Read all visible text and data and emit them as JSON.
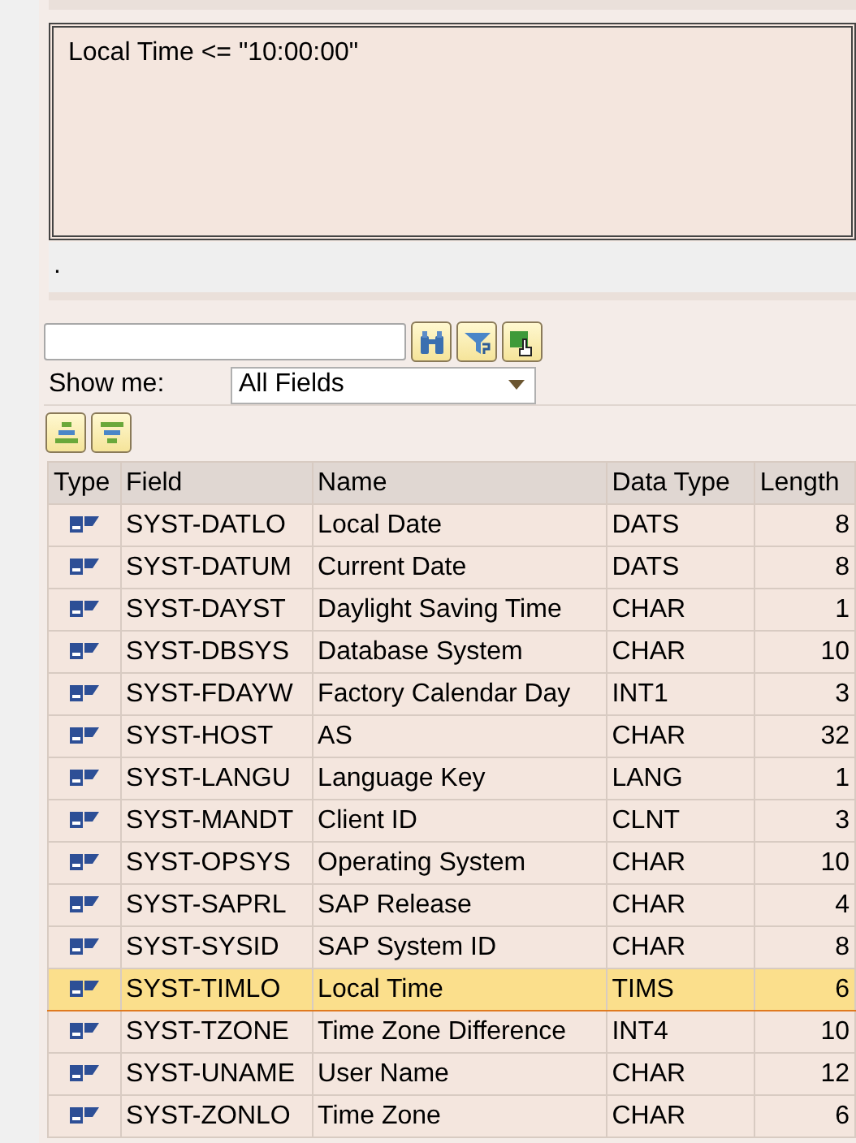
{
  "condition": {
    "text": "Local Time <= \"10:00:00\""
  },
  "status_text": ".",
  "filter": {
    "label": "Show me:",
    "value": "All Fields"
  },
  "table": {
    "columns": [
      "Type",
      "Field",
      "Name",
      "Data Type",
      "Length"
    ],
    "rows": [
      {
        "field": "SYST-DATLO",
        "name": "Local Date",
        "data_type": "DATS",
        "length": "8",
        "selected": false
      },
      {
        "field": "SYST-DATUM",
        "name": "Current Date",
        "data_type": "DATS",
        "length": "8",
        "selected": false
      },
      {
        "field": "SYST-DAYST",
        "name": "Daylight Saving Time",
        "data_type": "CHAR",
        "length": "1",
        "selected": false
      },
      {
        "field": "SYST-DBSYS",
        "name": "Database System",
        "data_type": "CHAR",
        "length": "10",
        "selected": false
      },
      {
        "field": "SYST-FDAYW",
        "name": "Factory Calendar Day",
        "data_type": "INT1",
        "length": "3",
        "selected": false
      },
      {
        "field": "SYST-HOST",
        "name": "AS",
        "data_type": "CHAR",
        "length": "32",
        "selected": false
      },
      {
        "field": "SYST-LANGU",
        "name": "Language Key",
        "data_type": "LANG",
        "length": "1",
        "selected": false
      },
      {
        "field": "SYST-MANDT",
        "name": "Client ID",
        "data_type": "CLNT",
        "length": "3",
        "selected": false
      },
      {
        "field": "SYST-OPSYS",
        "name": "Operating System",
        "data_type": "CHAR",
        "length": "10",
        "selected": false
      },
      {
        "field": "SYST-SAPRL",
        "name": "SAP Release",
        "data_type": "CHAR",
        "length": "4",
        "selected": false
      },
      {
        "field": "SYST-SYSID",
        "name": "SAP System ID",
        "data_type": "CHAR",
        "length": "8",
        "selected": false
      },
      {
        "field": "SYST-TIMLO",
        "name": "Local Time",
        "data_type": "TIMS",
        "length": "6",
        "selected": true
      },
      {
        "field": "SYST-TZONE",
        "name": "Time Zone Difference",
        "data_type": "INT4",
        "length": "10",
        "selected": false
      },
      {
        "field": "SYST-UNAME",
        "name": "User Name",
        "data_type": "CHAR",
        "length": "12",
        "selected": false
      },
      {
        "field": "SYST-ZONLO",
        "name": "Time Zone",
        "data_type": "CHAR",
        "length": "6",
        "selected": false
      }
    ]
  }
}
